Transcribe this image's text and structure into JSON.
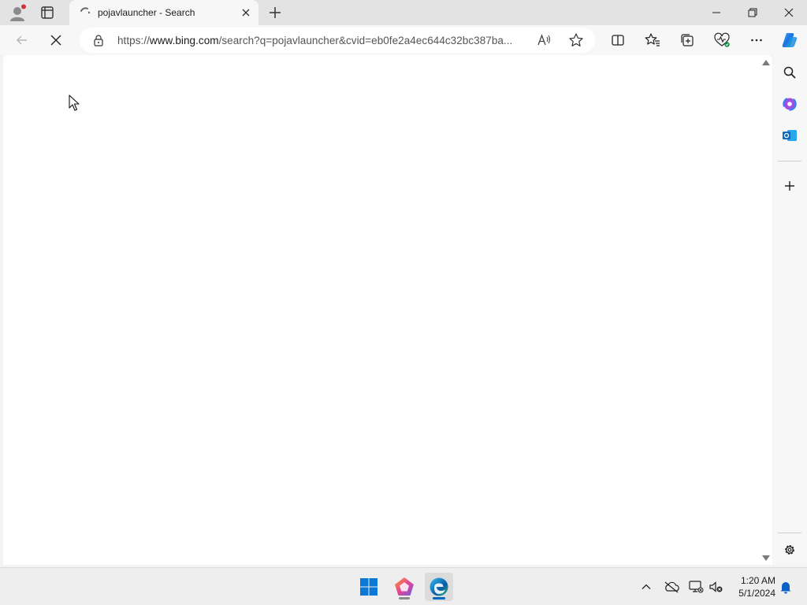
{
  "browser": {
    "tab": {
      "title": "pojavlauncher - Search",
      "loading": true
    },
    "address_bar": {
      "url": "https://www.bing.com/search?q=pojavlauncher&cvid=eb0fe2a4ec644c32bc387ba...",
      "url_prefix": "https://",
      "url_domain": "www.bing.com",
      "url_rest": "/search?q=pojavlauncher&cvid=eb0fe2a4ec644c32bc387ba..."
    },
    "toolbar_icons": [
      "back-icon",
      "stop-loading-icon",
      "lock-icon",
      "read-aloud-icon",
      "favorite-star-icon",
      "split-screen-icon",
      "favorites-icon",
      "collections-icon",
      "browser-essentials-icon",
      "more-icon",
      "copilot-icon"
    ],
    "sidebar_icons": [
      "search-icon",
      "copilot-compose-icon",
      "outlook-icon",
      "add-icon",
      "settings-icon"
    ]
  },
  "taskbar": {
    "clock_time": "1:20 AM",
    "clock_date": "5/1/2024",
    "apps": [
      "windows-start-icon",
      "app-pentagon-icon",
      "edge-icon"
    ],
    "tray": [
      "chevron-up-icon",
      "onedrive-icon",
      "network-icon",
      "volume-muted-icon",
      "notification-bell-icon"
    ]
  },
  "colors": {
    "accent": "#0067c0",
    "tab_bar": "#e3e3e3",
    "toolbar": "#f7f7f7",
    "notification_dot": "#d13438"
  }
}
